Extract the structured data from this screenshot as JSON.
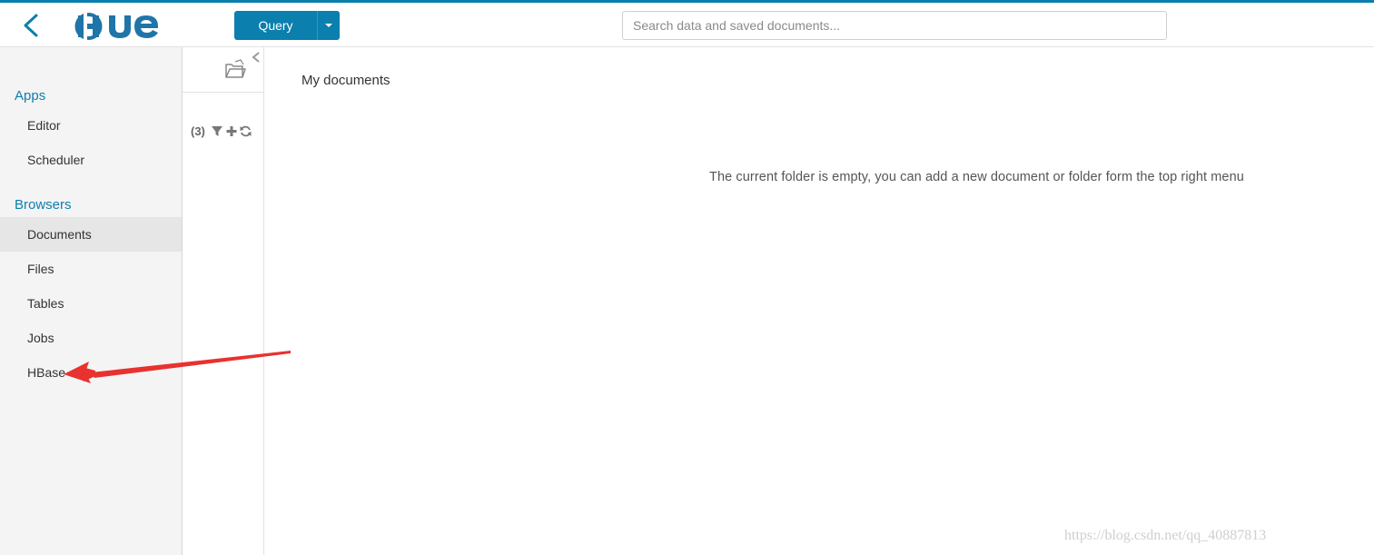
{
  "header": {
    "logo_text": "HUE",
    "query_label": "Query",
    "search_placeholder": "Search data and saved documents..."
  },
  "sidebar": {
    "apps_label": "Apps",
    "apps_items": [
      {
        "label": "Editor"
      },
      {
        "label": "Scheduler"
      }
    ],
    "browsers_label": "Browsers",
    "browsers_items": [
      {
        "label": "Documents",
        "active": true
      },
      {
        "label": "Files"
      },
      {
        "label": "Tables"
      },
      {
        "label": "Jobs"
      },
      {
        "label": "HBase"
      }
    ]
  },
  "folder_panel": {
    "count": "(3)"
  },
  "main": {
    "title": "My documents",
    "empty_message": "The current folder is empty, you can add a new document or folder form the top right menu"
  },
  "watermark": "https://blog.csdn.net/qq_40887813",
  "colors": {
    "brand": "#0b7fad",
    "sidebar_bg": "#f4f4f4",
    "active_bg": "#e6e6e6",
    "annotation_arrow": "#e8322f"
  },
  "icons": {
    "back": "chevron-left-icon",
    "caret": "caret-down-icon",
    "folder": "folder-open-icon",
    "collapse": "chevron-left-icon",
    "filter": "filter-icon",
    "add": "plus-icon",
    "refresh": "refresh-icon"
  }
}
